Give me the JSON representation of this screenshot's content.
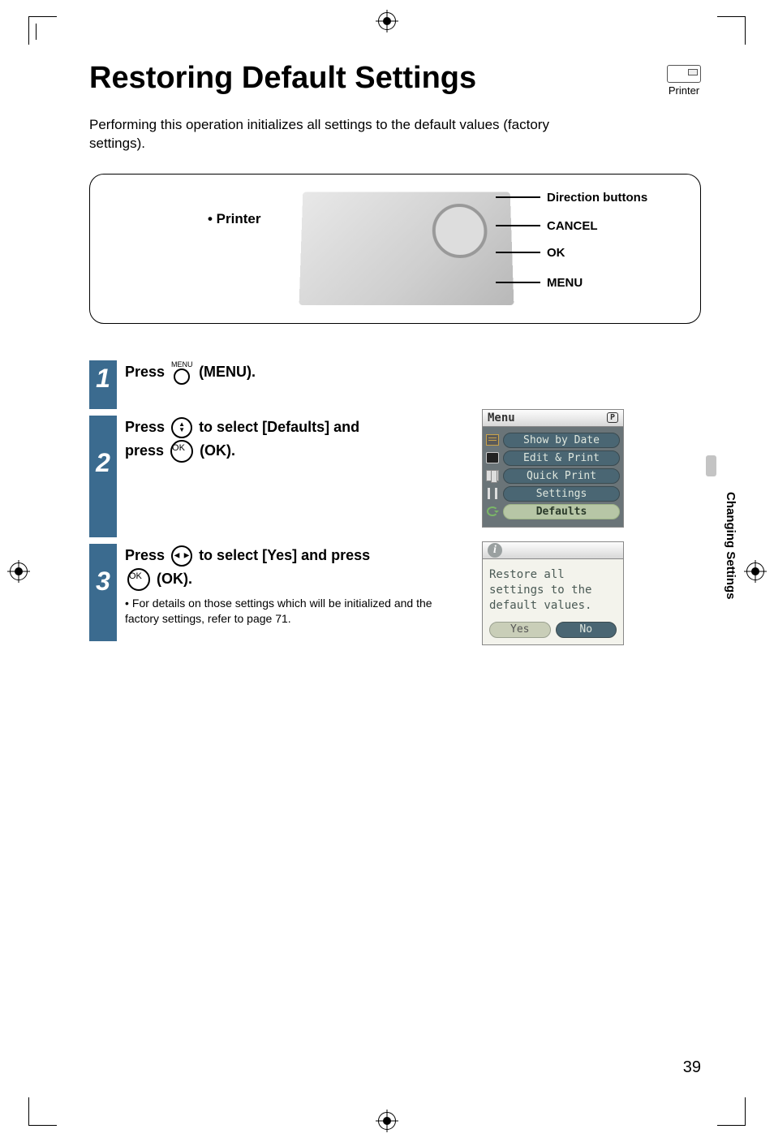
{
  "title": "Restoring Default Settings",
  "printer_badge": "Printer",
  "intro": "Performing this operation initializes all settings to the default values (factory settings).",
  "diagram": {
    "printer_label": "• Printer",
    "callouts": {
      "direction": "Direction buttons",
      "cancel": "CANCEL",
      "ok": "OK",
      "menu": "MENU"
    }
  },
  "steps": {
    "s1": {
      "num": "1",
      "pre": "Press ",
      "menu_label": "MENU",
      "post": " (MENU)."
    },
    "s2": {
      "num": "2",
      "line1_pre": "Press ",
      "line1_post": " to select [Defaults] and",
      "line2_pre": "press ",
      "ok_inner": "OK",
      "line2_post": " (OK)."
    },
    "s3": {
      "num": "3",
      "line1_pre": "Press ",
      "line1_post": " to select [Yes] and press",
      "ok_inner": "OK",
      "line2_post": " (OK).",
      "note": "For details on those settings which will be initialized and the factory settings, refer to page 71."
    }
  },
  "menu_screen": {
    "title": "Menu",
    "p": "P",
    "items": [
      "Show by Date",
      "Edit & Print",
      "Quick Print",
      "Settings",
      "Defaults"
    ],
    "selected_index": 4
  },
  "confirm_screen": {
    "info": "i",
    "msg1": "Restore all",
    "msg2": "settings to the",
    "msg3": "default values.",
    "yes": "Yes",
    "no": "No"
  },
  "side_tab": "Changing Settings",
  "page_number": "39"
}
